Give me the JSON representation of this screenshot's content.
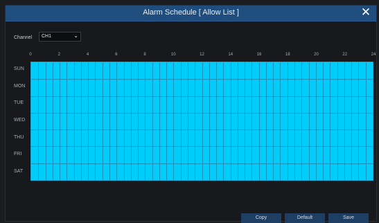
{
  "dialog": {
    "title": "Alarm Schedule [ Allow List ]",
    "close_icon": "close-icon"
  },
  "channel": {
    "label": "Channel",
    "value": "CH1",
    "dropdown_icon": "chevron-down-icon"
  },
  "schedule": {
    "hours": [
      "0",
      "2",
      "4",
      "6",
      "8",
      "10",
      "12",
      "14",
      "16",
      "18",
      "20",
      "22",
      "24"
    ],
    "days": [
      "SUN",
      "MON",
      "TUE",
      "WED",
      "THU",
      "FRI",
      "SAT"
    ],
    "all_hours_selected": true,
    "selected_color": "#00cdfa"
  },
  "buttons": {
    "copy": "Copy",
    "default": "Default",
    "save": "Save"
  },
  "colors": {
    "titlebar": "#1f4d7e",
    "background": "#17191c",
    "button": "#1e3f63"
  }
}
